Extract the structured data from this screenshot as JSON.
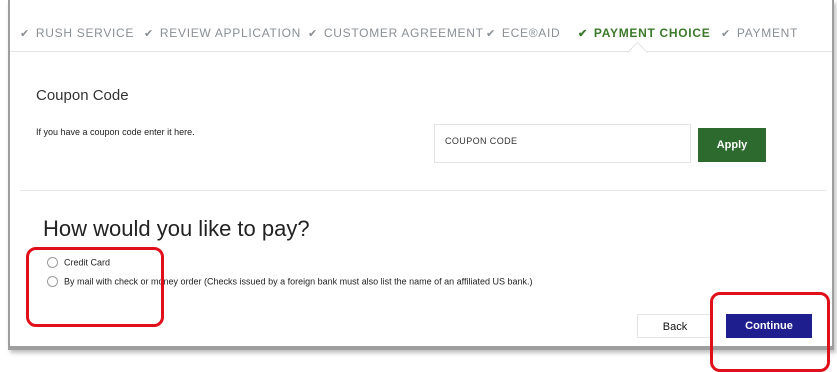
{
  "steps": [
    {
      "label": "RUSH SERVICE",
      "state": "done"
    },
    {
      "label": "REVIEW APPLICATION",
      "state": "done"
    },
    {
      "label": "CUSTOMER AGREEMENT",
      "state": "done"
    },
    {
      "label": "ECE®AID",
      "state": "done"
    },
    {
      "label": "PAYMENT CHOICE",
      "state": "active"
    },
    {
      "label": "PAYMENT",
      "state": "done"
    }
  ],
  "check_glyph": "✔",
  "coupon": {
    "title": "Coupon Code",
    "help_text": "If you have a coupon code enter it here.",
    "input_value": "COUPON CODE",
    "apply_label": "Apply"
  },
  "payment": {
    "title": "How would you like to pay?",
    "options": [
      {
        "label": "Credit Card",
        "selected": false
      },
      {
        "label": "By mail with check or money order (Checks issued by a foreign bank must also list the name of an affiliated US bank.)",
        "selected": false
      }
    ]
  },
  "actions": {
    "back_label": "Back",
    "continue_label": "Continue"
  },
  "colors": {
    "active_step": "#3b7a2b",
    "inactive_step": "#8a8f94",
    "apply_button": "#2d6a2e",
    "continue_button": "#1f1e8f",
    "annotation": "#e0101a"
  }
}
